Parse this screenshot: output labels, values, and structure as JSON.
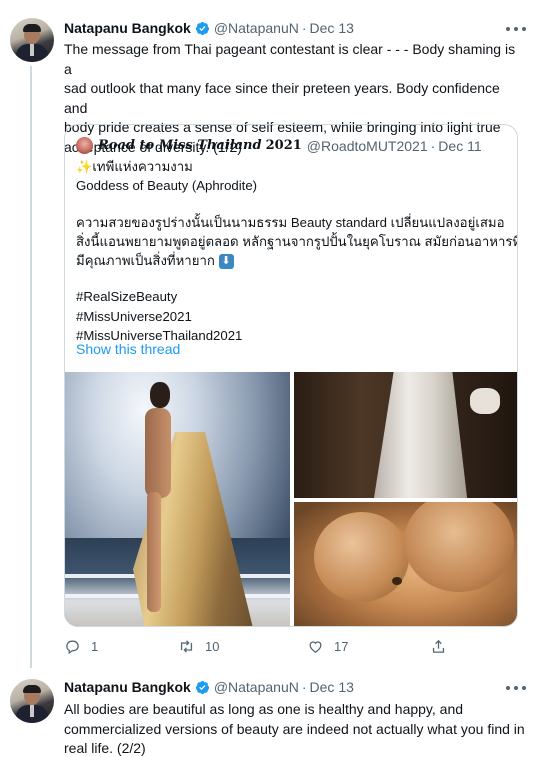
{
  "tweet1": {
    "name": "Natapanu Bangkok",
    "handle": "@NatapanuN",
    "date": "Dec 13",
    "text": "The message from Thai pageant contestant is clear - - - Body shaming is a\nsad outlook that many face since their preteen years. Body confidence and\nbody pride creates a sense of self esteem, while bringing into light true\nacceptance of diversity. (1/2)",
    "quote": {
      "name": "Road to Miss Thailand",
      "name_year": "2021",
      "handle": "@RoadtoMUT2021",
      "date": "Dec 11",
      "line1": "✨เทพีแห่งความงาม",
      "line2": "Goddess of Beauty (Aphrodite)",
      "line3": "ความสวยของรูปร่างนั้นเป็นนามธรรม Beauty standard เปลี่ยนแปลงอยู่เสมอ",
      "line4": "สิ่งนี้แอนพยายามพูดอยู่ตลอด หลักฐานจากรูปปั้นในยุคโบราณ สมัยก่อนอาหารที่",
      "line5": "มีคุณภาพเป็นสิ่งที่หายาก",
      "hashtag1": "#RealSizeBeauty",
      "hashtag2": "#MissUniverse2021",
      "hashtag3": "#MissUniverseThailand2021",
      "show_thread": "Show this thread"
    },
    "actions": {
      "reply_count": "1",
      "retweet_count": "10",
      "like_count": "17"
    }
  },
  "tweet2": {
    "name": "Natapanu Bangkok",
    "handle": "@NatapanuN",
    "date": "Dec 13",
    "text": "All bodies are beautiful as long as one is healthy and happy, and\ncommercialized versions of beauty are indeed not actually what you find in\nreal life. (2/2)"
  },
  "colors": {
    "accent": "#1d9bf0",
    "muted": "#536471",
    "border": "#cfd9de"
  },
  "icons": [
    "verified-badge-icon",
    "more-options-icon",
    "reply-icon",
    "retweet-icon",
    "like-icon",
    "share-icon",
    "down-arrow-emoji-icon"
  ]
}
